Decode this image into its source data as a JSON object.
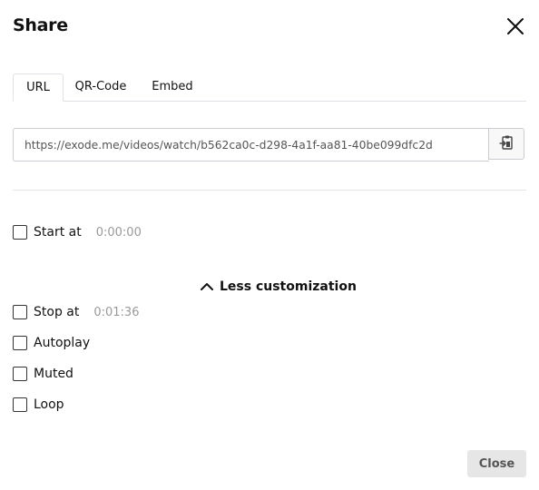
{
  "dialog": {
    "title": "Share"
  },
  "tabs": [
    {
      "label": "URL",
      "active": true
    },
    {
      "label": "QR-Code",
      "active": false
    },
    {
      "label": "Embed",
      "active": false
    }
  ],
  "url_field": {
    "value": "https://exode.me/videos/watch/b562ca0c-d298-4a1f-aa81-40be099dfc2d"
  },
  "options": {
    "start_at": {
      "label": "Start at",
      "time": "0:00:00",
      "checked": false
    },
    "toggle_label": "Less customization",
    "stop_at": {
      "label": "Stop at",
      "time": "0:01:36",
      "checked": false
    },
    "autoplay": {
      "label": "Autoplay",
      "checked": false
    },
    "muted": {
      "label": "Muted",
      "checked": false
    },
    "loop": {
      "label": "Loop",
      "checked": false
    }
  },
  "footer": {
    "close_label": "Close"
  },
  "icons": {
    "close": "close-icon",
    "copy": "clipboard-icon",
    "toggle": "chevron-up-icon"
  }
}
